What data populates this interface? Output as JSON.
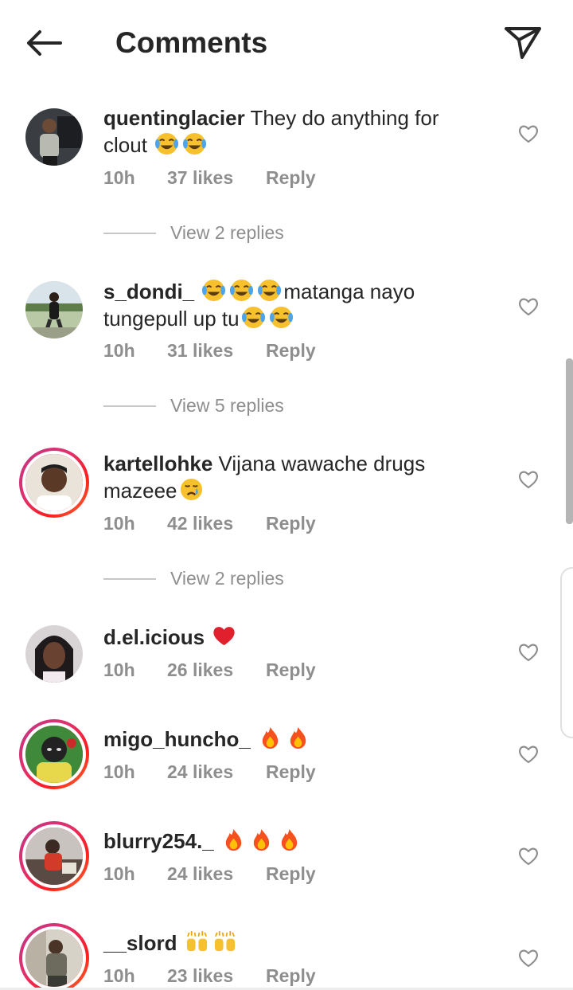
{
  "header": {
    "title": "Comments",
    "back_icon": "arrow-left-icon",
    "share_icon": "paper-plane-icon"
  },
  "colors": {
    "text": "#262626",
    "secondary": "#8e8e8e",
    "story_ring_start": "#c13584",
    "story_ring_end": "#f77737"
  },
  "comments": [
    {
      "username": "quentinglacier",
      "text_before": " They do anything for clout ",
      "emojis": [
        "face-with-tears-of-joy",
        "face-with-tears-of-joy"
      ],
      "text_after": "",
      "time": "10h",
      "likes": "37 likes",
      "reply_label": "Reply",
      "view_replies": "View 2 replies"
    },
    {
      "username": "s_dondi_",
      "text_before": " ",
      "emojis_mid": [
        "face-with-tears-of-joy",
        "face-with-tears-of-joy",
        "face-with-tears-of-joy"
      ],
      "text_mid": "matanga nayo tungepull up tu",
      "emojis": [
        "face-with-tears-of-joy",
        "face-with-tears-of-joy"
      ],
      "time": "10h",
      "likes": "31 likes",
      "reply_label": "Reply",
      "view_replies": "View 5 replies"
    },
    {
      "username": "kartellohke",
      "text_before": " Vijana wawache drugs mazeee",
      "emojis": [
        "crying-face"
      ],
      "time": "10h",
      "likes": "42 likes",
      "reply_label": "Reply",
      "view_replies": "View 2 replies"
    },
    {
      "username": "d.el.icious",
      "text_before": " ",
      "emojis": [
        "red-heart"
      ],
      "time": "10h",
      "likes": "26 likes",
      "reply_label": "Reply"
    },
    {
      "username": "migo_huncho_",
      "text_before": " ",
      "emojis": [
        "fire",
        "fire"
      ],
      "time": "10h",
      "likes": "24 likes",
      "reply_label": "Reply"
    },
    {
      "username": "blurry254._",
      "text_before": " ",
      "emojis": [
        "fire",
        "fire",
        "fire"
      ],
      "time": "10h",
      "likes": "24 likes",
      "reply_label": "Reply"
    },
    {
      "username": "__slord",
      "text_before": " ",
      "emojis": [
        "raising-hands",
        "raising-hands"
      ],
      "time": "10h",
      "likes": "23 likes",
      "reply_label": "Reply"
    }
  ]
}
